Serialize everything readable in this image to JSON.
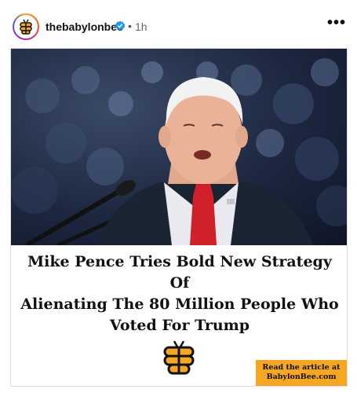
{
  "post": {
    "username": "thebabylonbee",
    "separator": "•",
    "time": "1h",
    "more_label": "•••"
  },
  "card": {
    "headline_lines": [
      "Mike Pence Tries Bold New Strategy Of",
      "Alienating The 80 Million People Who",
      "Voted For Trump"
    ],
    "cta_lines": [
      "Read the article at",
      "BabylonBee.com"
    ]
  },
  "colors": {
    "cta_background": "#f5a623",
    "verified_badge": "#1d9bf0",
    "tie_red": "#d0202a",
    "suit_navy": "#1b2433"
  },
  "icons": {
    "avatar": "babylon-bee-logo-icon",
    "verified": "verified-badge-icon",
    "more": "more-options-icon",
    "brand": "bee-logo-icon"
  }
}
